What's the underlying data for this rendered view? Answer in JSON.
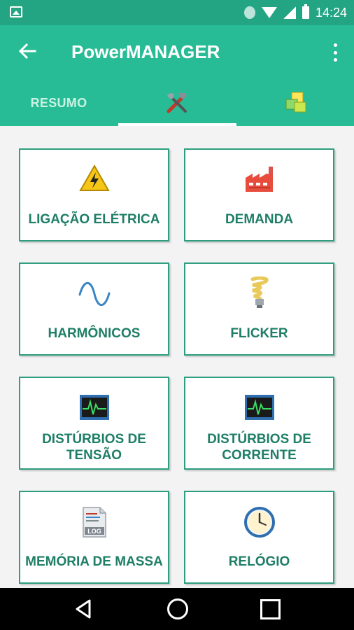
{
  "status_bar": {
    "time": "14:24"
  },
  "app_bar": {
    "title": "PowerMANAGER"
  },
  "tabs": [
    {
      "label": "RESUMO",
      "selected": false
    },
    {
      "icon": "tools-icon",
      "selected": true
    },
    {
      "icon": "cubes-icon",
      "selected": false
    }
  ],
  "menu": [
    {
      "label": "LIGAÇÃO ELÉTRICA",
      "icon": "warning-electric-icon"
    },
    {
      "label": "DEMANDA",
      "icon": "factory-icon"
    },
    {
      "label": "HARMÔNICOS",
      "icon": "sine-wave-icon"
    },
    {
      "label": "FLICKER",
      "icon": "light-bulb-icon"
    },
    {
      "label": "DISTÚRBIOS DE TENSÃO",
      "icon": "monitor-waveform-icon"
    },
    {
      "label": "DISTÚRBIOS DE CORRENTE",
      "icon": "monitor-waveform-icon"
    },
    {
      "label": "MEMÓRIA DE MASSA",
      "icon": "log-file-icon"
    },
    {
      "label": "RELÓGIO",
      "icon": "clock-icon"
    }
  ],
  "colors": {
    "primary": "#27bc95",
    "status": "#23a583",
    "card_text": "#1e7e66",
    "card_border": "#2f9d7f"
  }
}
